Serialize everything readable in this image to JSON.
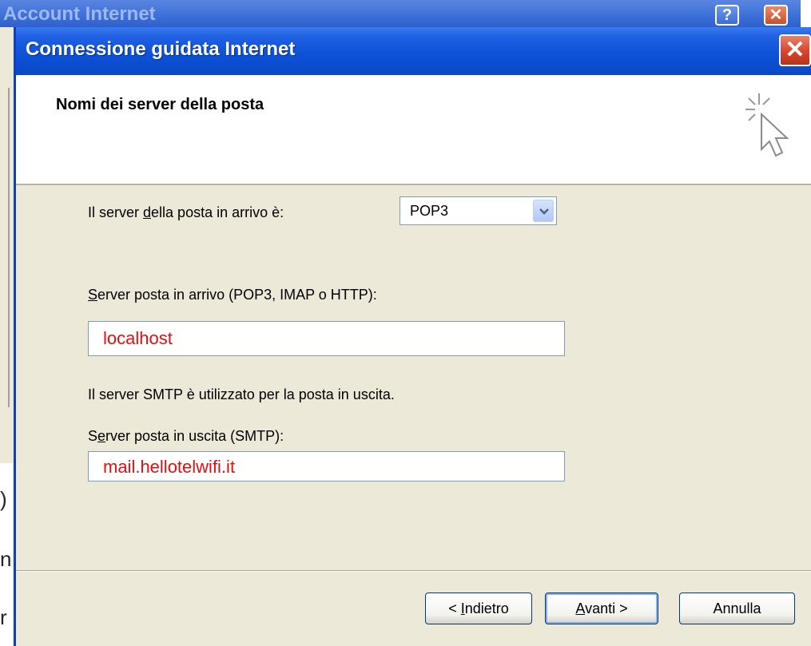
{
  "background_window": {
    "title": "Account Internet",
    "help_label": "?",
    "close_label": "✕",
    "edge_glyphs": [
      ")",
      "n",
      "r"
    ]
  },
  "dialog": {
    "title": "Connessione guidata Internet",
    "close_label": "✕",
    "header_title": "Nomi dei server della posta",
    "incoming_type_label": {
      "pre": "Il server ",
      "key": "d",
      "post": "ella posta in arrivo è:"
    },
    "incoming_type_value": "POP3",
    "incoming_server_label": {
      "key": "S",
      "post": "erver posta in arrivo (POP3, IMAP o HTTP):"
    },
    "incoming_server_value": "localhost",
    "smtp_info": "Il server SMTP è utilizzato per la posta in uscita.",
    "outgoing_server_label": {
      "pre": "S",
      "key": "e",
      "post": "rver posta in uscita (SMTP):"
    },
    "outgoing_server_value": "mail.hellotelwifi.it"
  },
  "buttons": {
    "back": {
      "pre": "< ",
      "key": "I",
      "post": "ndietro"
    },
    "next": {
      "key": "A",
      "post": "vanti >"
    },
    "cancel": "Annulla"
  }
}
